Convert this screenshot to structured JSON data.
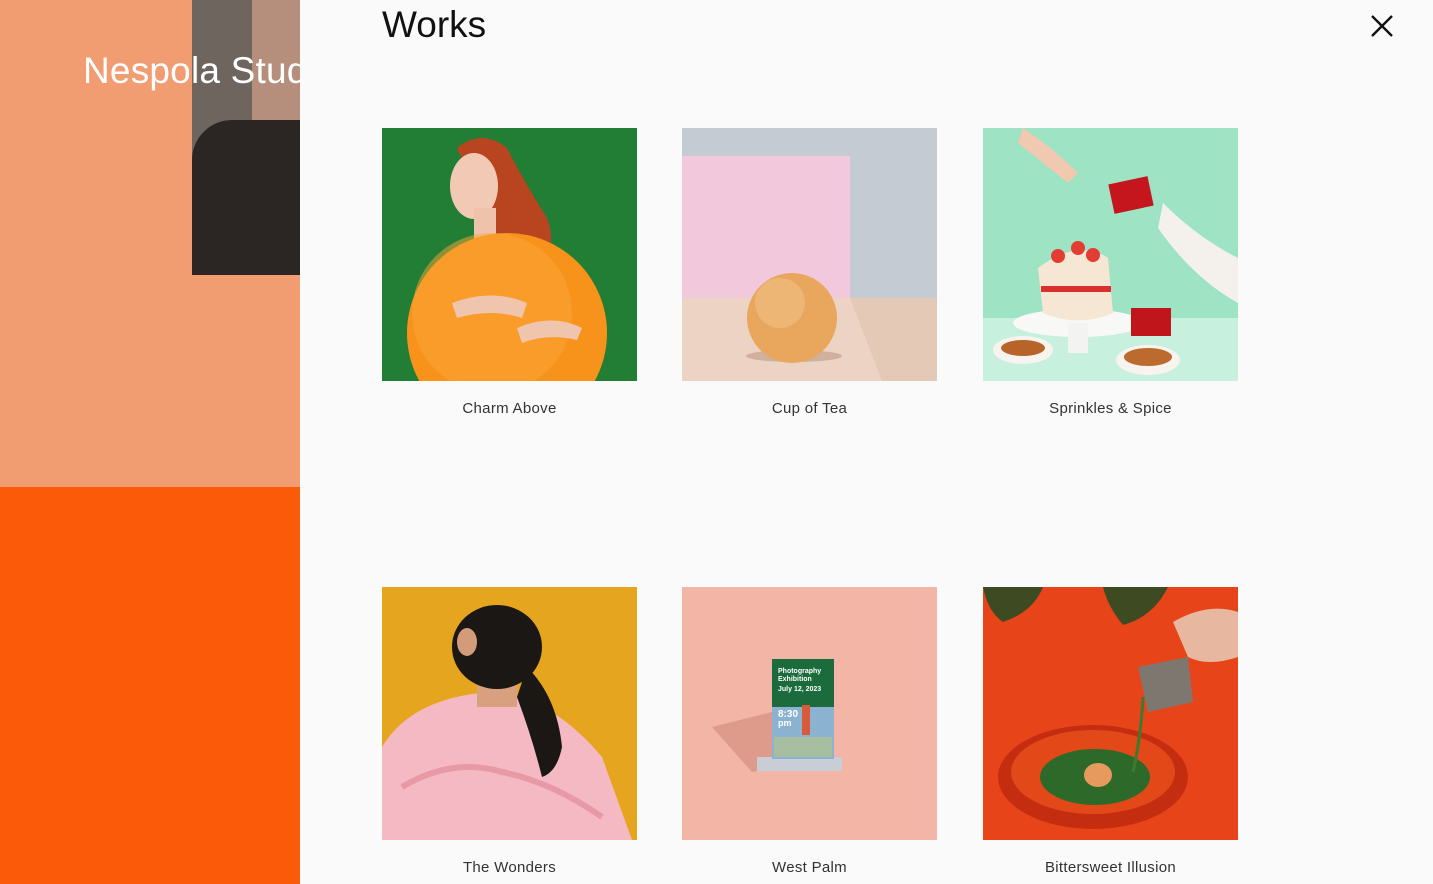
{
  "background": {
    "brand_text": "Nespola Stud",
    "colors": {
      "peach": "#f29c72",
      "orange": "#fb5a08"
    }
  },
  "modal": {
    "title": "Works",
    "close_icon": "close-icon",
    "works": [
      {
        "title": "Charm Above",
        "image": "woman-holding-orange-ball"
      },
      {
        "title": "Cup of Tea",
        "image": "grapefruit-on-table"
      },
      {
        "title": "Sprinkles & Spice",
        "image": "strawberry-cake-with-gifts"
      },
      {
        "title": "The Wonders",
        "image": "woman-in-pink-puffer-jacket"
      },
      {
        "title": "West Palm",
        "image": "exhibition-poster-stand"
      },
      {
        "title": "Bittersweet Illusion",
        "image": "pouring-green-soup"
      }
    ],
    "poster": {
      "line1": "Photography",
      "line2": "Exhibition",
      "date": "July 12, 2023",
      "time": "8:30",
      "ampm": "pm"
    }
  }
}
